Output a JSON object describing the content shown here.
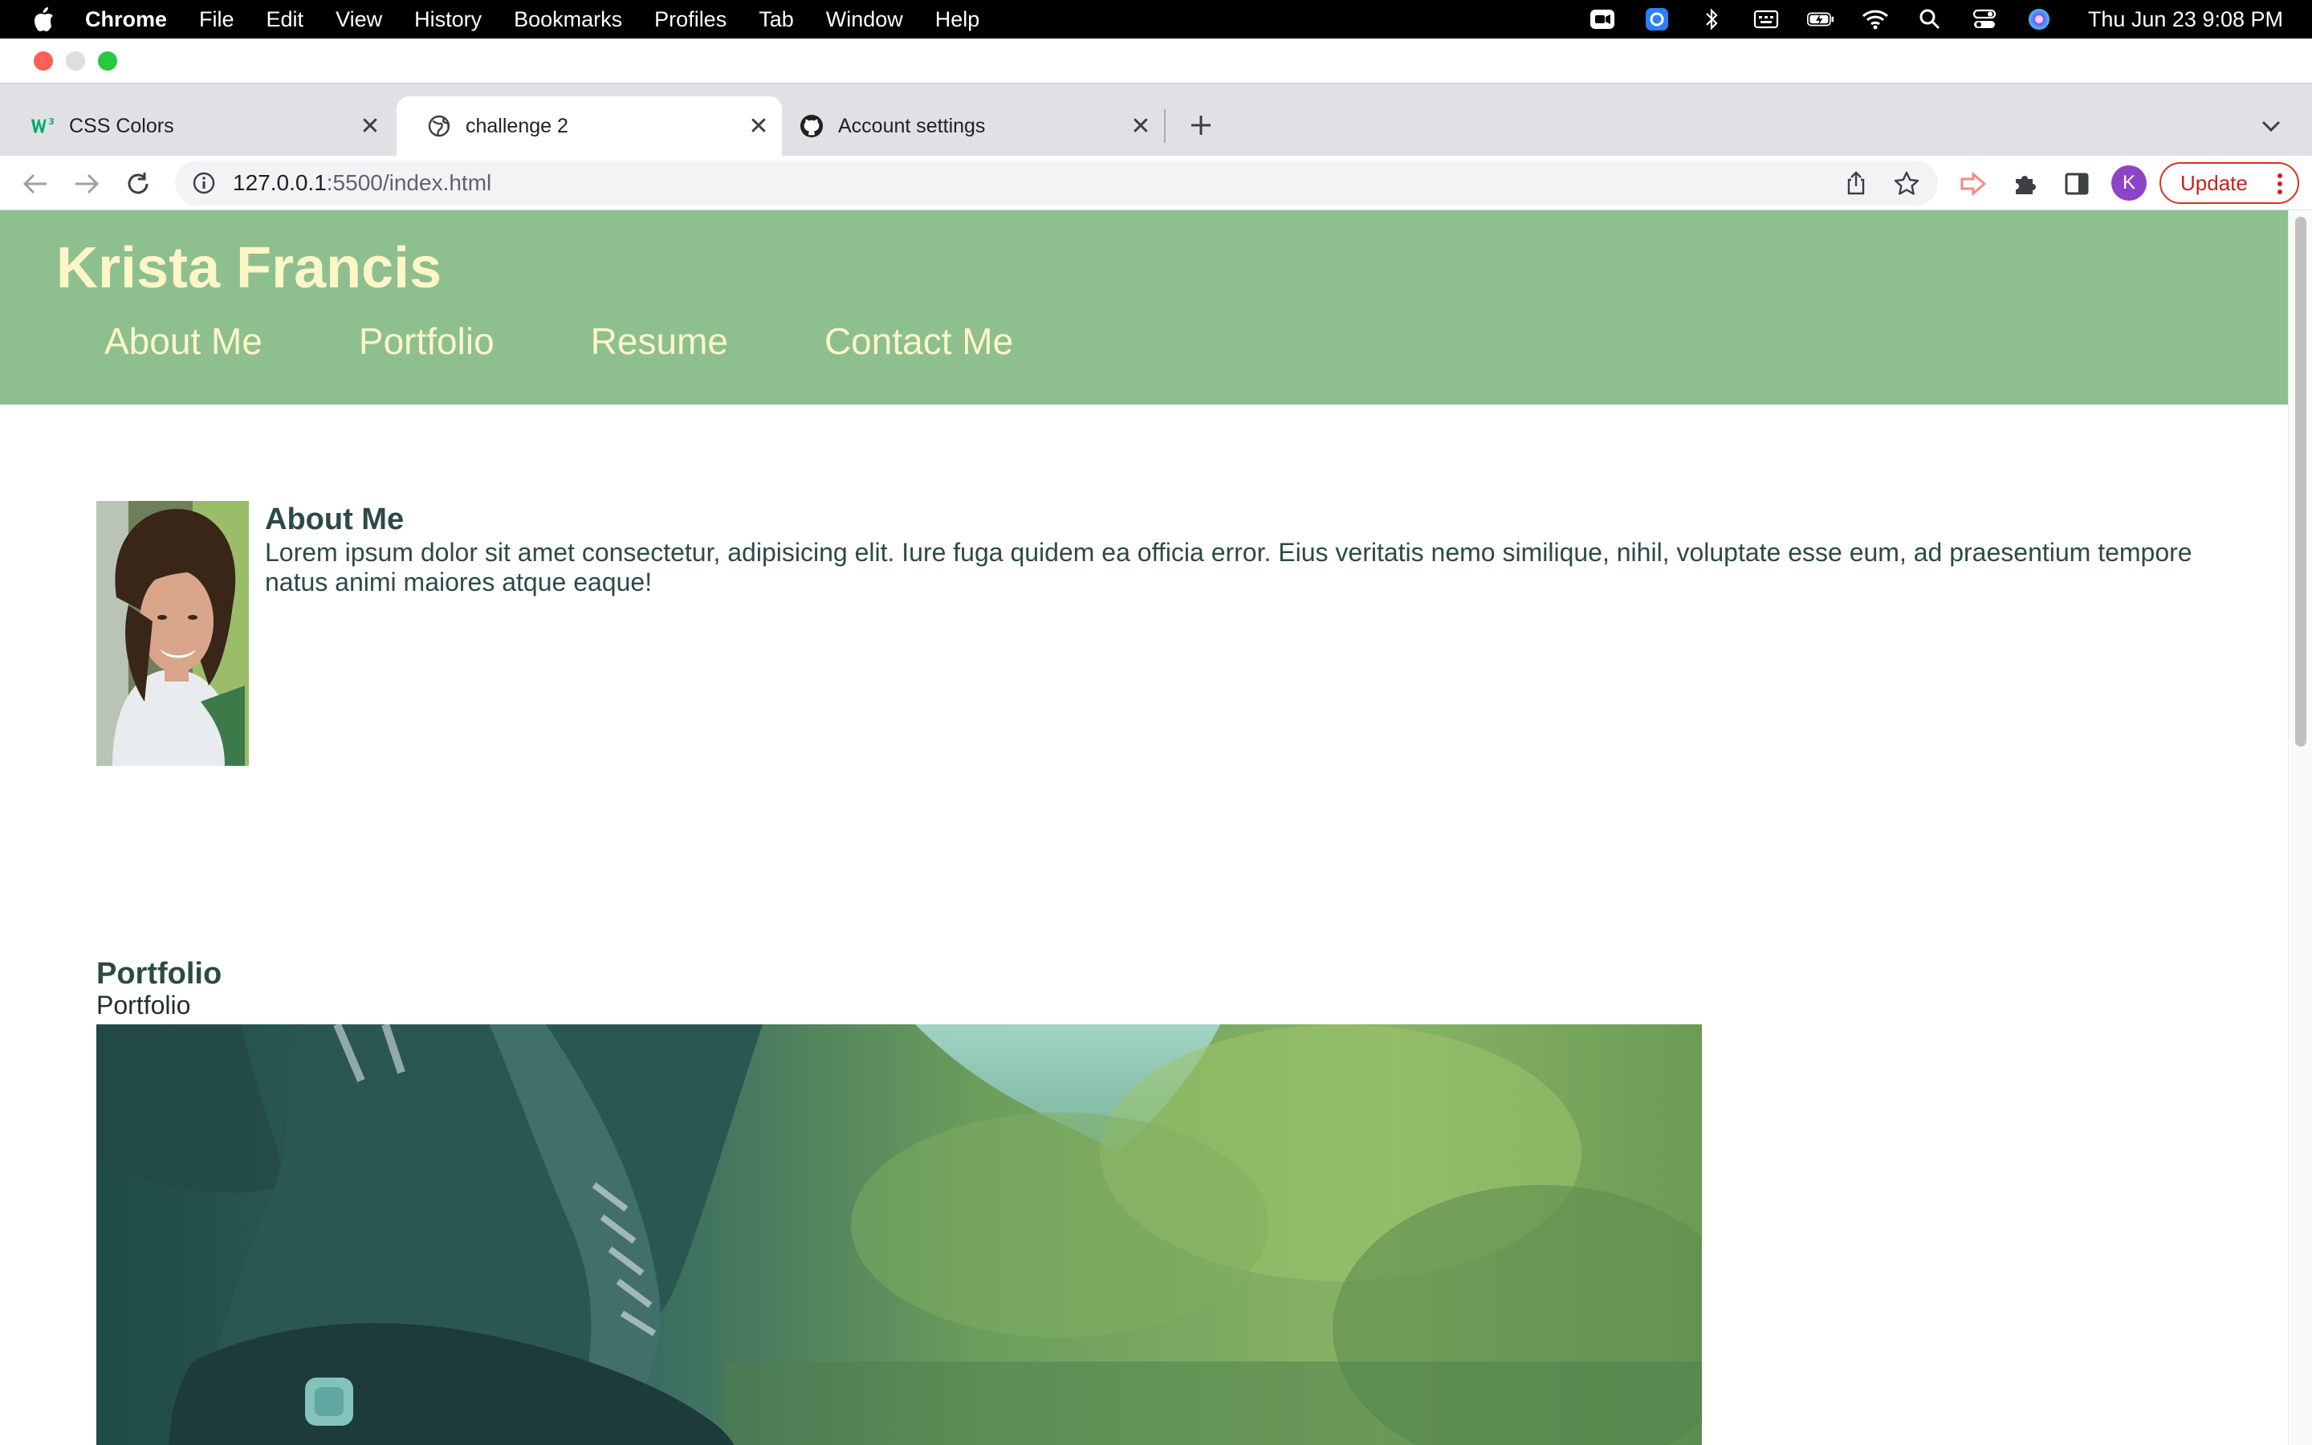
{
  "menubar": {
    "app": "Chrome",
    "items": [
      "File",
      "Edit",
      "View",
      "History",
      "Bookmarks",
      "Profiles",
      "Tab",
      "Window",
      "Help"
    ],
    "clock": "Thu Jun 23  9:08 PM"
  },
  "tabs": [
    {
      "title": "CSS Colors",
      "icon": "w3schools-icon",
      "active": false
    },
    {
      "title": "challenge 2",
      "icon": "globe-icon",
      "active": true
    },
    {
      "title": "Account settings",
      "icon": "github-icon",
      "active": false
    }
  ],
  "omnibox": {
    "host": "127.0.0.1",
    "path": ":5500/index.html"
  },
  "profile": {
    "initial": "K",
    "color": "#8e44c7"
  },
  "update_label": "Update",
  "site": {
    "title": "Krista Francis",
    "nav": [
      "About Me",
      "Portfolio",
      "Resume",
      "Contact Me"
    ],
    "header_color": "#8ebf8f",
    "header_text_color": "#fdf6c6",
    "about": {
      "heading": "About Me",
      "body": "Lorem ipsum dolor sit amet consectetur, adipisicing elit. Iure fuga quidem ea officia error. Eius veritatis nemo similique, nihil, voluptate esse eum, ad praesentium tempore natus animi maiores atque eaque!"
    },
    "portfolio": {
      "heading": "Portfolio",
      "subtext": "Portfolio"
    }
  }
}
